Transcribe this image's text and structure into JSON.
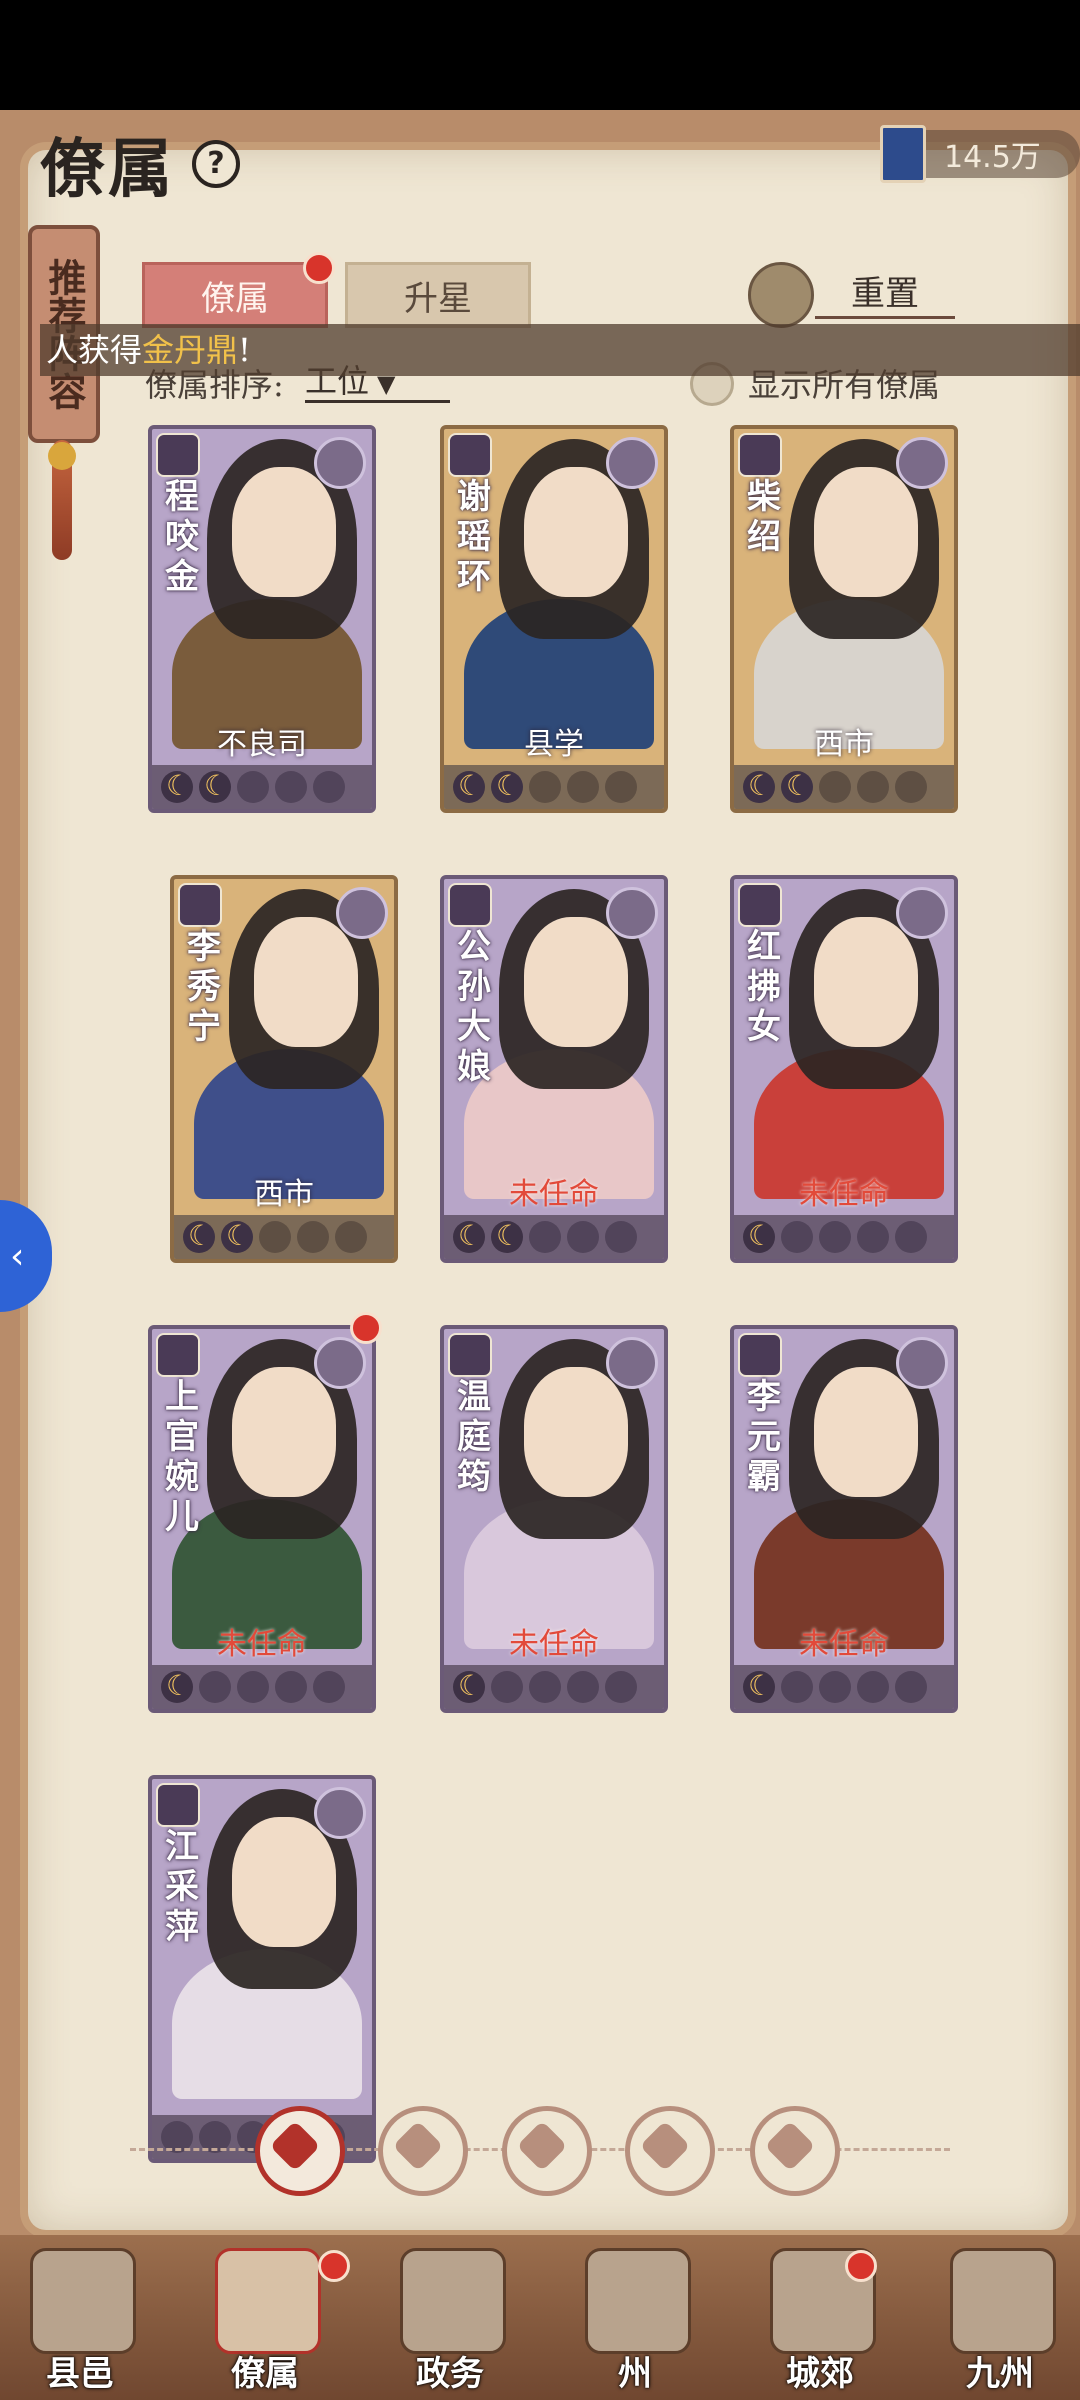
{
  "header": {
    "title": "僚属",
    "help": "?",
    "currency": "14.5万"
  },
  "side_tag": {
    "label": "推荐阵容"
  },
  "tabs": [
    {
      "label": "僚属"
    },
    {
      "label": "升星"
    }
  ],
  "reset": {
    "label": "重置"
  },
  "notice": {
    "prefix": "人获得",
    "item": "金丹鼎",
    "suffix": "!"
  },
  "sort": {
    "label": "僚属排序:",
    "value": "工位",
    "chevron": "▼"
  },
  "show_all": {
    "label": "显示所有僚属"
  },
  "cards": [
    {
      "name": "程咬金",
      "status": "不良司",
      "stars_on": 2,
      "theme": "purple"
    },
    {
      "name": "谢瑶环",
      "status": "县学",
      "stars_on": 2,
      "theme": "gold"
    },
    {
      "name": "柴绍",
      "status": "西市",
      "stars_on": 2,
      "theme": "gold"
    },
    {
      "name": "李秀宁",
      "status": "西市",
      "stars_on": 2,
      "theme": "gold"
    },
    {
      "name": "公孙大娘",
      "status": "未任命",
      "stars_on": 2,
      "theme": "purple"
    },
    {
      "name": "红拂女",
      "status": "未任命",
      "stars_on": 1,
      "theme": "purple"
    },
    {
      "name": "上官婉儿",
      "status": "未任命",
      "stars_on": 1,
      "theme": "purple"
    },
    {
      "name": "温庭筠",
      "status": "未任命",
      "stars_on": 1,
      "theme": "purple"
    },
    {
      "name": "李元霸",
      "status": "未任命",
      "stars_on": 1,
      "theme": "purple"
    },
    {
      "name": "江采萍",
      "status": "",
      "stars_on": 0,
      "theme": "purple"
    }
  ],
  "nav": [
    {
      "label": "县邑"
    },
    {
      "label": "僚属"
    },
    {
      "label": "政务"
    },
    {
      "label": "州"
    },
    {
      "label": "城郊"
    },
    {
      "label": "九州"
    }
  ],
  "colors": {
    "accent_red": "#b2322a",
    "paper": "#efe6d3",
    "card_purple": "#b7a5c8",
    "card_gold": "#d9b37a",
    "unassigned": "#e24a3a"
  }
}
